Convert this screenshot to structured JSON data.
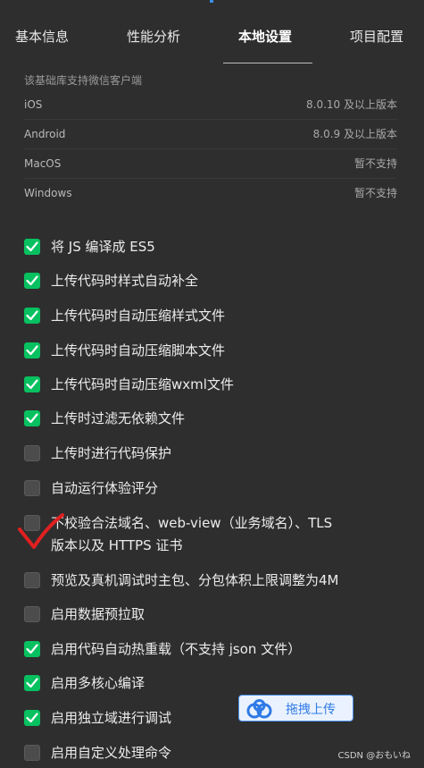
{
  "tabs": [
    {
      "label": "基本信息"
    },
    {
      "label": "性能分析"
    },
    {
      "label": "本地设置"
    },
    {
      "label": "项目配置"
    }
  ],
  "support": {
    "header": "该基础库支持微信客户端",
    "rows": [
      {
        "platform": "iOS",
        "value": "8.0.10 及以上版本"
      },
      {
        "platform": "Android",
        "value": "8.0.9 及以上版本"
      },
      {
        "platform": "MacOS",
        "value": "暂不支持"
      },
      {
        "platform": "Windows",
        "value": "暂不支持"
      }
    ]
  },
  "options": [
    {
      "label": "将 JS 编译成 ES5",
      "checked": true
    },
    {
      "label": "上传代码时样式自动补全",
      "checked": true
    },
    {
      "label": "上传代码时自动压缩样式文件",
      "checked": true
    },
    {
      "label": "上传代码时自动压缩脚本文件",
      "checked": true
    },
    {
      "label": "上传代码时自动压缩wxml文件",
      "checked": true
    },
    {
      "label": "上传时过滤无依赖文件",
      "checked": true
    },
    {
      "label": "上传时进行代码保护",
      "checked": false
    },
    {
      "label": "自动运行体验评分",
      "checked": false
    },
    {
      "label": "不校验合法域名、web-view（业务域名）、TLS",
      "label2": "版本以及 HTTPS 证书",
      "checked": false
    },
    {
      "label": "预览及真机调试时主包、分包体积上限调整为4M",
      "checked": false
    },
    {
      "label": "启用数据预拉取",
      "checked": false
    },
    {
      "label": "启用代码自动热重载（不支持 json 文件）",
      "checked": true
    },
    {
      "label": "启用多核心编译",
      "checked": true
    },
    {
      "label": "启用独立域进行调试",
      "checked": true
    },
    {
      "label": "启用自定义处理命令",
      "checked": false
    }
  ],
  "upload_button": {
    "label": "拖拽上传",
    "icon": "cloud-upload-icon"
  },
  "watermark": "CSDN @おもいね",
  "colors": {
    "accent": "#07c160",
    "background": "#2e2e2e",
    "upload_blue": "#2f7ae5",
    "scribble_red": "#e02020"
  }
}
